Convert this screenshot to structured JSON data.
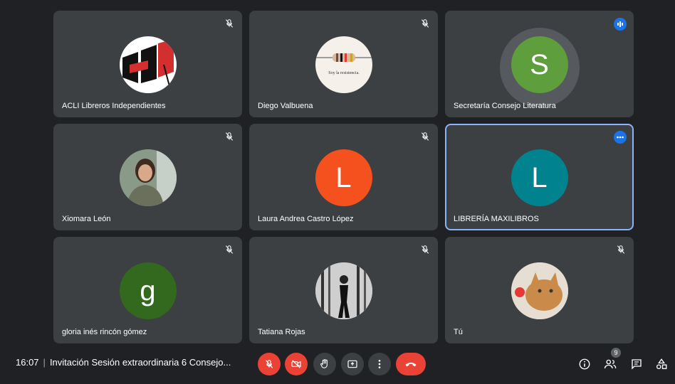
{
  "participants": [
    {
      "name": "ACLI Libreros Independientes",
      "avatar": "logo",
      "muted": true
    },
    {
      "name": "Diego Valbuena",
      "avatar": "photo",
      "caption": "Soy la resistencia.",
      "muted": true
    },
    {
      "name": "Secretaría Consejo Literatura",
      "avatar": "letter",
      "letter": "S",
      "color": "#5e9e3c",
      "speaking": true
    },
    {
      "name": "Xiomara León",
      "avatar": "photo",
      "muted": true
    },
    {
      "name": "Laura Andrea Castro López",
      "avatar": "letter",
      "letter": "L",
      "color": "#f4511e",
      "muted": true
    },
    {
      "name": "LIBRERÍA MAXILIBROS",
      "avatar": "letter",
      "letter": "L",
      "color": "#00838f",
      "pinned": true
    },
    {
      "name": "gloria inés rincón gómez",
      "avatar": "letter",
      "letter": "g",
      "color": "#33691e",
      "muted": true
    },
    {
      "name": "Tatiana Rojas",
      "avatar": "photo",
      "muted": true
    },
    {
      "name": "Tú",
      "avatar": "photo",
      "muted": true
    }
  ],
  "bottom_bar": {
    "time": "16:07",
    "separator": "|",
    "meeting_title": "Invitación Sesión extraordinaria 6 Consejo...",
    "participant_count": "9"
  },
  "controls": [
    "microphone-off",
    "camera-off",
    "raise-hand",
    "present-screen",
    "more-options",
    "leave-call"
  ],
  "side_controls": [
    "meeting-details",
    "people",
    "chat",
    "activities"
  ],
  "colors": {
    "background": "#202124",
    "tile": "#3c4043",
    "danger": "#ea4335",
    "accent": "#1a73e8",
    "active_border": "#8ab4f8"
  }
}
